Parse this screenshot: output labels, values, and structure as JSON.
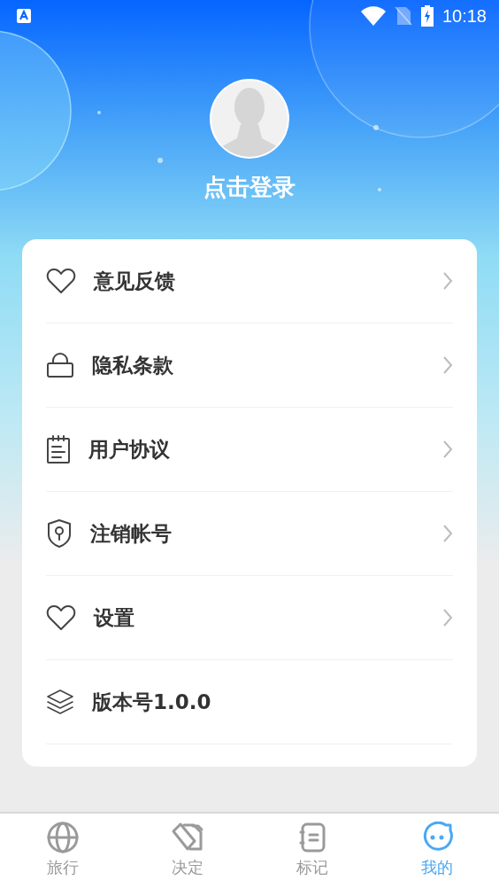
{
  "status_bar": {
    "time": "10:18"
  },
  "profile": {
    "login_label": "点击登录"
  },
  "menu": [
    {
      "kind": "heart",
      "label": "意见反馈",
      "arrow": true
    },
    {
      "kind": "lock",
      "label": "隐私条款",
      "arrow": true
    },
    {
      "kind": "notepad",
      "label": "用户协议",
      "arrow": true
    },
    {
      "kind": "shield",
      "label": "注销帐号",
      "arrow": true
    },
    {
      "kind": "heart",
      "label": "设置",
      "arrow": true
    },
    {
      "kind": "layers",
      "label": "版本号1.0.0",
      "arrow": false
    }
  ],
  "tabs": [
    {
      "kind": "globe",
      "label": "旅行",
      "selected": false
    },
    {
      "kind": "cards",
      "label": "决定",
      "selected": false
    },
    {
      "kind": "notebook",
      "label": "标记",
      "selected": false
    },
    {
      "kind": "face",
      "label": "我的",
      "selected": true
    }
  ]
}
